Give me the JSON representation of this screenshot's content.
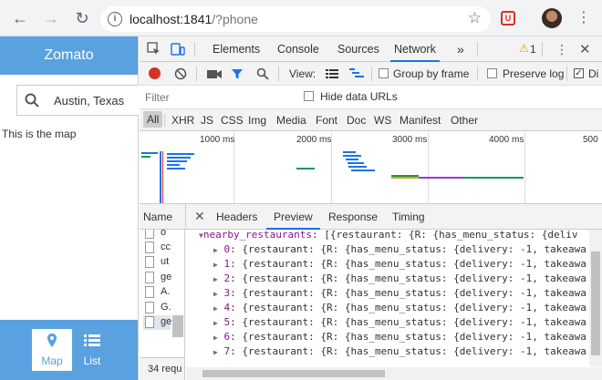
{
  "browser": {
    "url_host": "localhost:1841",
    "url_path": "/?phone"
  },
  "app": {
    "title": "Zomato",
    "search_value": "Austin, Texas",
    "map_text": "This is the map",
    "nav": [
      {
        "label": "Map",
        "icon": "map-pin-icon"
      },
      {
        "label": "List",
        "icon": "list-icon"
      }
    ]
  },
  "devtools": {
    "tabs": [
      "Elements",
      "Console",
      "Sources",
      "Network"
    ],
    "active_tab": "Network",
    "more": "»",
    "warnings_count": "1",
    "view_label": "View:",
    "group_by_frame": "Group by frame",
    "preserve_log": "Preserve log",
    "disable_cache_abbrev": "Di",
    "filter_placeholder": "Filter",
    "hide_data_urls": "Hide data URLs",
    "types": [
      "All",
      "XHR",
      "JS",
      "CSS",
      "Img",
      "Media",
      "Font",
      "Doc",
      "WS",
      "Manifest",
      "Other"
    ],
    "timeline_ticks": [
      "1000 ms",
      "2000 ms",
      "3000 ms",
      "4000 ms",
      "500"
    ],
    "name_header": "Name",
    "panel_tabs": [
      "Headers",
      "Preview",
      "Response",
      "Timing"
    ],
    "active_panel": "Preview",
    "name_rows": [
      "o",
      "cc",
      "ut",
      "ge",
      "A.",
      "G.",
      "ge"
    ],
    "status_text": "34 requ",
    "preview_root_key": "nearby_restaurants",
    "preview_root_val": "[{restaurant: {R: {has_menu_status: {deliv",
    "preview_items": [
      {
        "idx": "0",
        "val": "{restaurant: {R: {has_menu_status: {delivery: -1, takeawa"
      },
      {
        "idx": "1",
        "val": "{restaurant: {R: {has_menu_status: {delivery: -1, takeawa"
      },
      {
        "idx": "2",
        "val": "{restaurant: {R: {has_menu_status: {delivery: -1, takeawa"
      },
      {
        "idx": "3",
        "val": "{restaurant: {R: {has_menu_status: {delivery: -1, takeawa"
      },
      {
        "idx": "4",
        "val": "{restaurant: {R: {has_menu_status: {delivery: -1, takeawa"
      },
      {
        "idx": "5",
        "val": "{restaurant: {R: {has_menu_status: {delivery: -1, takeawa"
      },
      {
        "idx": "6",
        "val": "{restaurant: {R: {has_menu_status: {delivery: -1, takeawa"
      },
      {
        "idx": "7",
        "val": "{restaurant: {R: {has_menu_status: {delivery: -1, takeawa"
      }
    ]
  },
  "colors": {
    "accent": "#5aa1e0",
    "devtools_blue": "#1a73e8",
    "record_red": "#d93025"
  }
}
